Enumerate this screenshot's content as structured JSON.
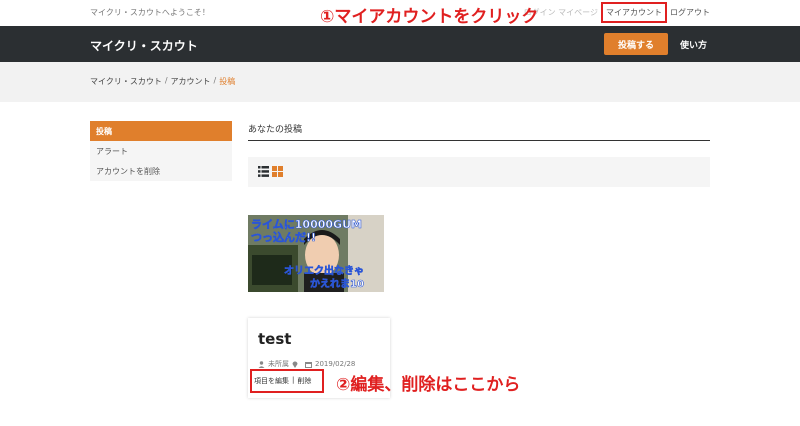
{
  "topbar": {
    "welcome": "マイクリ・スカウトへようこそ！",
    "hidden_links": "ログイン マイページ",
    "my_account": "マイアカウント",
    "logout": "ログアウト"
  },
  "header": {
    "brand": "マイクリ・スカウト",
    "post_button": "投稿する",
    "howto": "使い方"
  },
  "breadcrumb": {
    "items": [
      "マイクリ・スカウト",
      "アカウント",
      "投稿"
    ],
    "separator": "/"
  },
  "sidebar": {
    "items": [
      {
        "label": "投稿",
        "active": true
      },
      {
        "label": "アラート"
      },
      {
        "label": "アカウントを削除"
      }
    ]
  },
  "main": {
    "title": "あなたの投稿"
  },
  "thumbnail": {
    "text_top_1": "ライムに10000GUM",
    "text_top_2": "つっ込んだ!!",
    "text_bottom_1": "オリエク出なきゃ",
    "text_bottom_2": "かえれま10"
  },
  "post": {
    "title": "test",
    "category": "未所属",
    "date": "2019/02/28",
    "edit": "項目を編集",
    "action_sep": "|",
    "delete": "削除"
  },
  "annotations": {
    "step1": "①マイアカウントをクリック",
    "step2": "②編集、削除はここから"
  },
  "colors": {
    "accent": "#e07f2c",
    "header_bg": "#2b2f32",
    "annotation_red": "#e02020"
  }
}
